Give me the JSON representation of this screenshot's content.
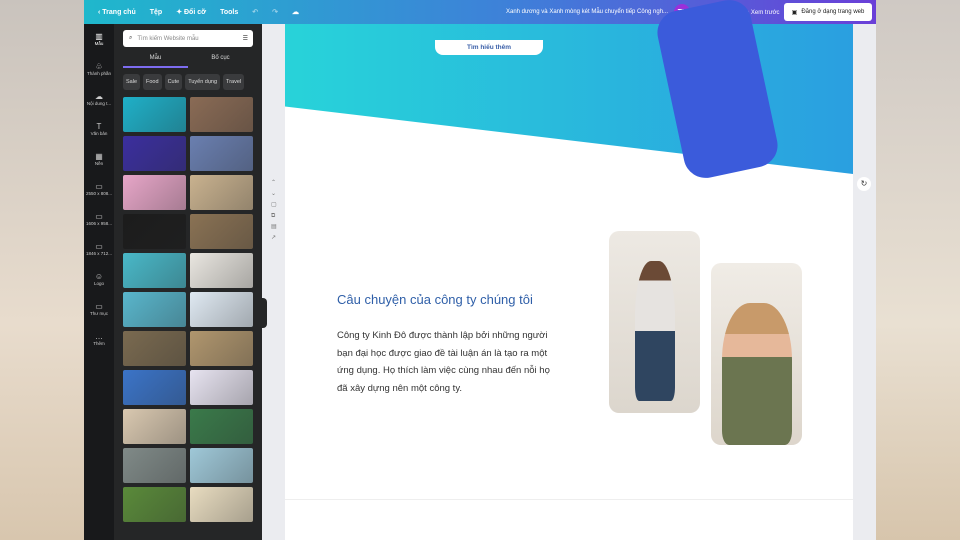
{
  "topbar": {
    "back": "Trang chủ",
    "file": "Tệp",
    "resize": "Đổi cỡ",
    "tools": "Tools",
    "title": "Xanh dương và Xanh mòng két Mẫu chuyển tiếp Công ngh...",
    "avatar": "TL",
    "preview": "Xem trước",
    "publish": "Đăng ở dạng trang web"
  },
  "rail": [
    {
      "icon": "▥",
      "label": "Mẫu"
    },
    {
      "icon": "♧",
      "label": "Thành phần"
    },
    {
      "icon": "☁",
      "label": "Nội dung t..."
    },
    {
      "icon": "T",
      "label": "Văn bản"
    },
    {
      "icon": "▦",
      "label": "Nền"
    },
    {
      "icon": "▭",
      "label": "2550 x 808..."
    },
    {
      "icon": "▭",
      "label": "1606 x 958..."
    },
    {
      "icon": "▭",
      "label": "1846 x 712..."
    },
    {
      "icon": "☺",
      "label": "Logo"
    },
    {
      "icon": "▭",
      "label": "Thư mục"
    },
    {
      "icon": "…",
      "label": "Thêm"
    }
  ],
  "panel": {
    "search_placeholder": "Tìm kiếm Website mẫu",
    "tabs": [
      "Mẫu",
      "Bố cục"
    ],
    "chips": [
      "Sale",
      "Food",
      "Cute",
      "Tuyển dụng",
      "Travel"
    ]
  },
  "thumb_colors": [
    "#1fb0c8",
    "#8a6b55",
    "#3b2f9e",
    "#6a7fb0",
    "#e7a6c8",
    "#c9b28f",
    "#1c1c1c",
    "#8a7254",
    "#49b8c8",
    "#e9e6e0",
    "#59b6cc",
    "#dfe9f2",
    "#7a6a50",
    "#b0966e",
    "#3b74c8",
    "#e7e3f0",
    "#d9c8b0",
    "#3a7a4a",
    "#808a88",
    "#9fc8d8",
    "#5a8a3a",
    "#e8dcc0"
  ],
  "canvas": {
    "cta": "Tìm hiểu thêm",
    "heading": "Câu chuyện của công ty chúng tôi",
    "body": "Công ty Kinh Đô được thành lập bởi những người bạn đại học được giao đề tài luận án là tạo ra một ứng dụng. Họ thích làm việc cùng nhau đến nỗi họ đã xây dựng nên một công ty."
  }
}
